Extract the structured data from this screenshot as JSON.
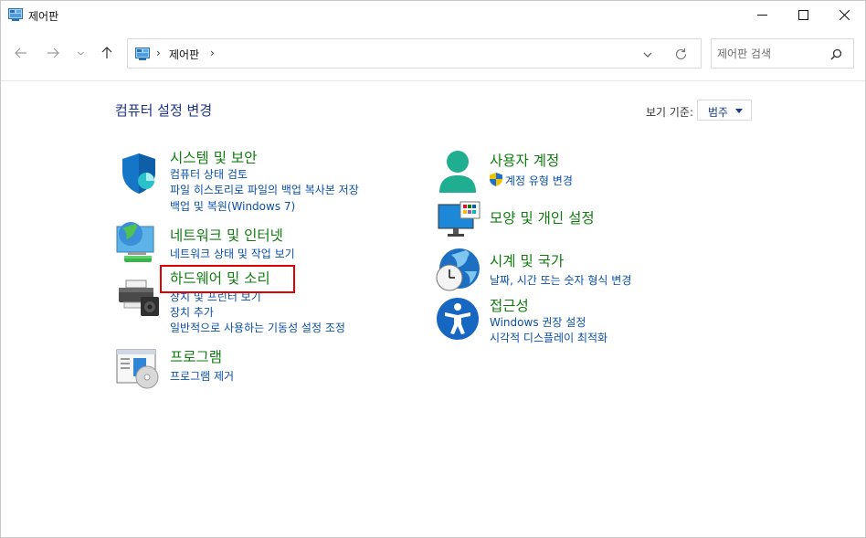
{
  "window": {
    "title": "제어판"
  },
  "address": {
    "crumb": "제어판",
    "sep": "›"
  },
  "search": {
    "placeholder": "제어판 검색"
  },
  "header": {
    "title": "컴퓨터 설정 변경",
    "view_by_label": "보기 기준:",
    "view_by_value": "범주"
  },
  "categories": {
    "security": {
      "title": "시스템 및 보안",
      "links": [
        "컴퓨터 상태 검토",
        "파일 히스토리로 파일의 백업 복사본 저장",
        "백업 및 복원(Windows 7)"
      ]
    },
    "network": {
      "title": "네트워크 및 인터넷",
      "links": [
        "네트워크 상태 및 작업 보기"
      ]
    },
    "hardware": {
      "title": "하드웨어 및 소리",
      "links": [
        "장치 및 프린터 보기",
        "장치 추가",
        "일반적으로 사용하는 기동성 설정 조정"
      ]
    },
    "programs": {
      "title": "프로그램",
      "links": [
        "프로그램 제거"
      ]
    },
    "users": {
      "title": "사용자 계정",
      "links": [
        "계정 유형 변경"
      ]
    },
    "appearance": {
      "title": "모양 및 개인 설정",
      "links": []
    },
    "clock": {
      "title": "시계 및 국가",
      "links": [
        "날짜, 시간 또는 숫자 형식 변경"
      ]
    },
    "ease": {
      "title": "접근성",
      "links": [
        "Windows 권장 설정",
        "시각적 디스플레이 최적화"
      ]
    }
  },
  "colors": {
    "category_title": "#107c10",
    "link": "#0a50a8",
    "header": "#1e3287",
    "highlight": "#e00000"
  },
  "icons": [
    "control-panel-icon",
    "back-arrow-icon",
    "forward-arrow-icon",
    "chevron-down-icon",
    "up-arrow-icon",
    "refresh-icon",
    "search-icon",
    "shield-icon",
    "network-globe-icon",
    "printer-icon",
    "programs-disc-icon",
    "user-icon",
    "monitor-palette-icon",
    "clock-globe-icon",
    "accessibility-icon",
    "uac-shield-icon"
  ]
}
